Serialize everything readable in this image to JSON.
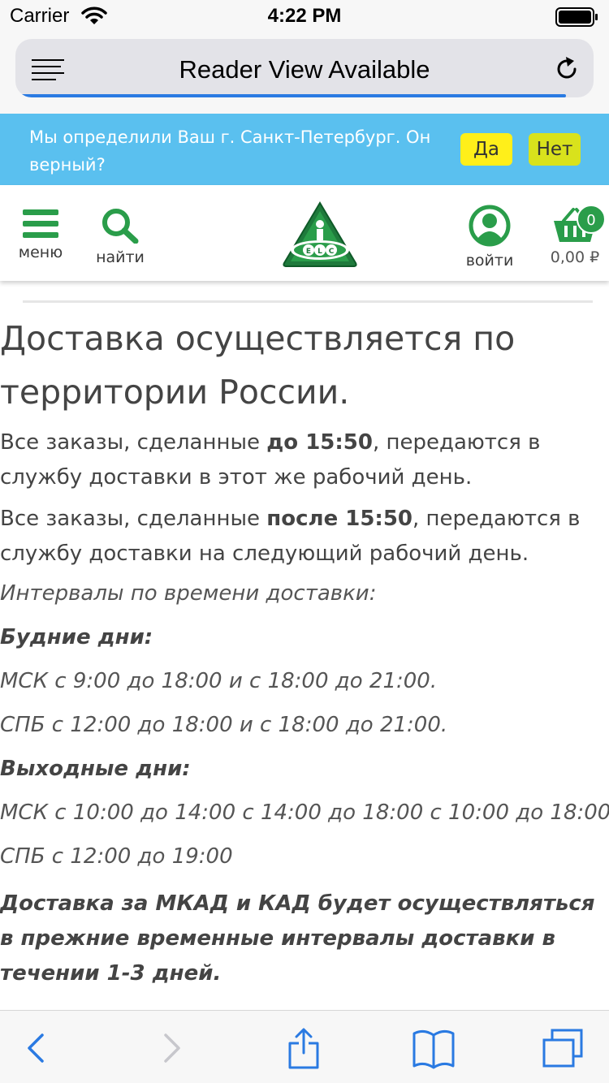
{
  "status_bar": {
    "carrier": "Carrier",
    "time": "4:22 PM"
  },
  "browser": {
    "address_title": "Reader View Available",
    "load_progress": 0.96
  },
  "city_banner": {
    "text": "Мы определили Ваш г. Санкт-Петербург. Он верный?",
    "yes_label": "Да",
    "no_label": "Нет"
  },
  "header": {
    "menu_label": "меню",
    "search_label": "найти",
    "login_label": "войти",
    "logo_text": "ELC",
    "cart_count": "0",
    "cart_total": "0,00 ₽"
  },
  "content": {
    "heading": "Доставка осуществляется по территории России.",
    "p1_before": "Все заказы, сделанные ",
    "p1_bold": "до 15:50",
    "p1_after": ", передаются в службу доставки в этот же рабочий день.",
    "p2_before": "Все заказы, сделанные ",
    "p2_bold": "после 15:50",
    "p2_after": ", передаются в службу доставки на следующий рабочий день.",
    "intervals_title": "Интервалы по времени доставки:",
    "weekdays_title": "Будние дни:",
    "weekdays_msk": "МСК с 9:00 до 18:00 и с 18:00 до 21:00.",
    "weekdays_spb": "СПБ с 12:00 до 18:00 и с 18:00 до 21:00.",
    "weekends_title": "Выходные дни:",
    "weekends_msk": "МСК с 10:00 до 14:00 с 14:00 до 18:00 с 10:00 до 18:00",
    "weekends_spb": "СПБ с 12:00 до 19:00",
    "mkad_note": "Доставка за МКАД и КАД будет осуществляться в прежние временные интервалы доставки в течении 1-3 дней."
  },
  "colors": {
    "banner_bg": "#5ac0ef",
    "yes_button": "#ffef1a",
    "no_button": "#d9e21c",
    "brand_green": "#2a9d4a",
    "ios_blue": "#2a7ae2"
  },
  "icons": {
    "menu": "hamburger-icon",
    "search": "search-icon",
    "login": "user-icon",
    "cart": "basket-icon",
    "back": "chevron-left-icon",
    "forward": "chevron-right-icon",
    "share": "share-icon",
    "bookmarks": "book-icon",
    "tabs": "tabs-icon"
  }
}
